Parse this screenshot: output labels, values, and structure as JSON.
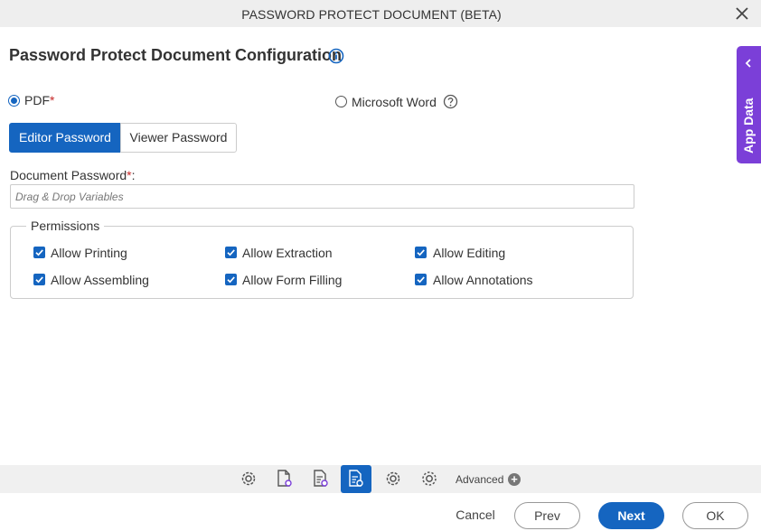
{
  "dialog": {
    "title": "PASSWORD PROTECT DOCUMENT (BETA)"
  },
  "page": {
    "heading": "Password Protect Document Configuration"
  },
  "document_type": {
    "pdf_label": "PDF",
    "pdf_required": "*",
    "word_label": "Microsoft Word",
    "selected": "PDF"
  },
  "tabs": [
    {
      "label": "Editor Password",
      "active": true
    },
    {
      "label": "Viewer Password",
      "active": false
    }
  ],
  "password_field": {
    "label": "Document Password",
    "required": "*",
    "suffix": ":",
    "placeholder": "Drag & Drop Variables"
  },
  "permissions": {
    "legend": "Permissions",
    "items": [
      {
        "label": "Allow Printing",
        "checked": true
      },
      {
        "label": "Allow Extraction",
        "checked": true
      },
      {
        "label": "Allow Editing",
        "checked": true
      },
      {
        "label": "Allow Assembling",
        "checked": true
      },
      {
        "label": "Allow Form Filling",
        "checked": true
      },
      {
        "label": "Allow Annotations",
        "checked": true
      }
    ]
  },
  "side_panel": {
    "label": "App Data"
  },
  "toolbar": {
    "icons": [
      "settings-gear-icon",
      "document-settings-icon",
      "document-list-settings-icon",
      "document-lock-icon",
      "gear-icon",
      "gear-alt-icon"
    ],
    "advanced_label": "Advanced"
  },
  "footer": {
    "cancel_label": "Cancel",
    "prev_label": "Prev",
    "next_label": "Next",
    "ok_label": "OK"
  },
  "colors": {
    "primary": "#1565c0",
    "side_panel": "#7b3fd8",
    "required": "#c62828"
  }
}
